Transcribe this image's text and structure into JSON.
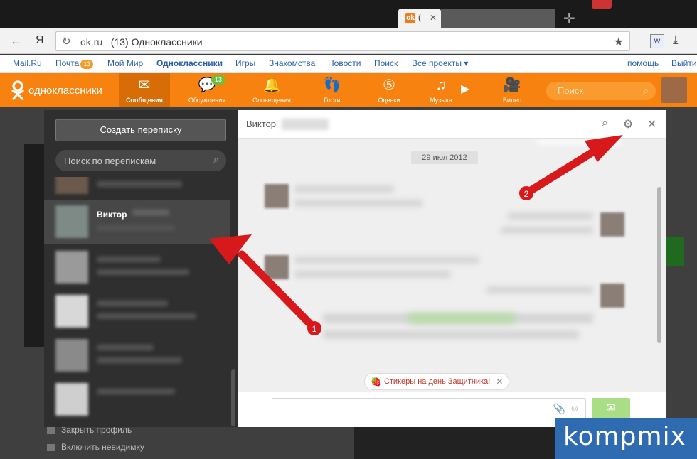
{
  "browser": {
    "active_tab_title": "(",
    "url_host": "ok.ru",
    "page_title": "(13) Одноклассники",
    "yandex_glyph": "Я"
  },
  "portal_links": [
    {
      "label": "Mail.Ru"
    },
    {
      "label": "Почта",
      "badge": "13"
    },
    {
      "label": "Мой Мир"
    },
    {
      "label": "Одноклассники"
    },
    {
      "label": "Игры"
    },
    {
      "label": "Знакомства"
    },
    {
      "label": "Новости"
    },
    {
      "label": "Поиск"
    },
    {
      "label": "Все проекты ▾"
    },
    {
      "label": "помощь"
    },
    {
      "label": "Выйти"
    }
  ],
  "ok_header": {
    "logo_text": "одноклассники",
    "nav": [
      {
        "label": "Сообщения",
        "icon": "envelope-icon",
        "active": true
      },
      {
        "label": "Обсуждения",
        "icon": "chat-bubbles-icon",
        "badge": "13"
      },
      {
        "label": "Оповещения",
        "icon": "bell-icon"
      },
      {
        "label": "Гости",
        "icon": "footprints-icon"
      },
      {
        "label": "Оценки",
        "icon": "five-rating-icon"
      },
      {
        "label": "Музыка",
        "icon": "music-note-icon"
      },
      {
        "label": "Видео",
        "icon": "video-camera-icon"
      }
    ],
    "search_placeholder": "Поиск"
  },
  "messages": {
    "create_button": "Создать переписку",
    "search_placeholder": "Поиск по перепискам",
    "active_contact_name": "Виктор",
    "chat_header_name": "Виктор",
    "date_label": "29 июл 2012",
    "sticker_promo": "Стикеры на день Защитника!"
  },
  "background_links": [
    "Закрыть профиль",
    "Включить невидимку"
  ],
  "annotations": {
    "callout_1": "1",
    "callout_2": "2",
    "watermark": "kompmix"
  },
  "colors": {
    "ok_orange": "#f7820f",
    "annotation_red": "#d8191b",
    "send_green": "#a9de86"
  }
}
